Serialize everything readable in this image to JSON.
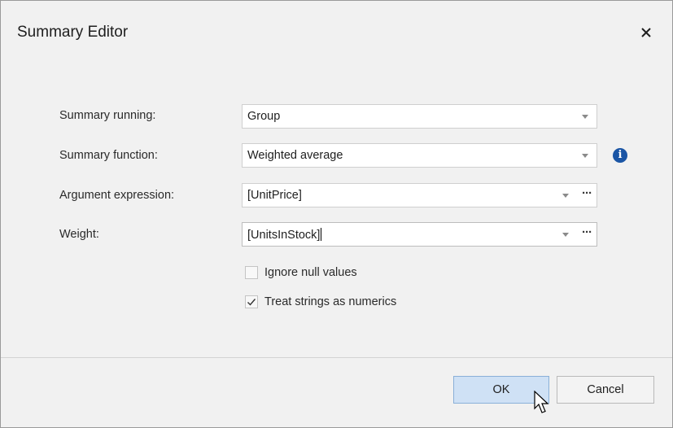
{
  "window": {
    "title": "Summary Editor"
  },
  "fields": {
    "summary_running": {
      "label": "Summary running:",
      "value": "Group"
    },
    "summary_function": {
      "label": "Summary function:",
      "value": "Weighted average"
    },
    "argument_expression": {
      "label": "Argument expression:",
      "value": "[UnitPrice]"
    },
    "weight": {
      "label": "Weight:",
      "value": "[UnitsInStock]"
    }
  },
  "checkboxes": {
    "ignore_null": {
      "label": "Ignore null values",
      "checked": false
    },
    "treat_strings": {
      "label": "Treat strings as numerics",
      "checked": true
    }
  },
  "buttons": {
    "ok": "OK",
    "cancel": "Cancel",
    "ellipsis": "···",
    "info": "i"
  },
  "colors": {
    "accent": "#1a55a5",
    "ok_button": "#cfe1f5"
  }
}
